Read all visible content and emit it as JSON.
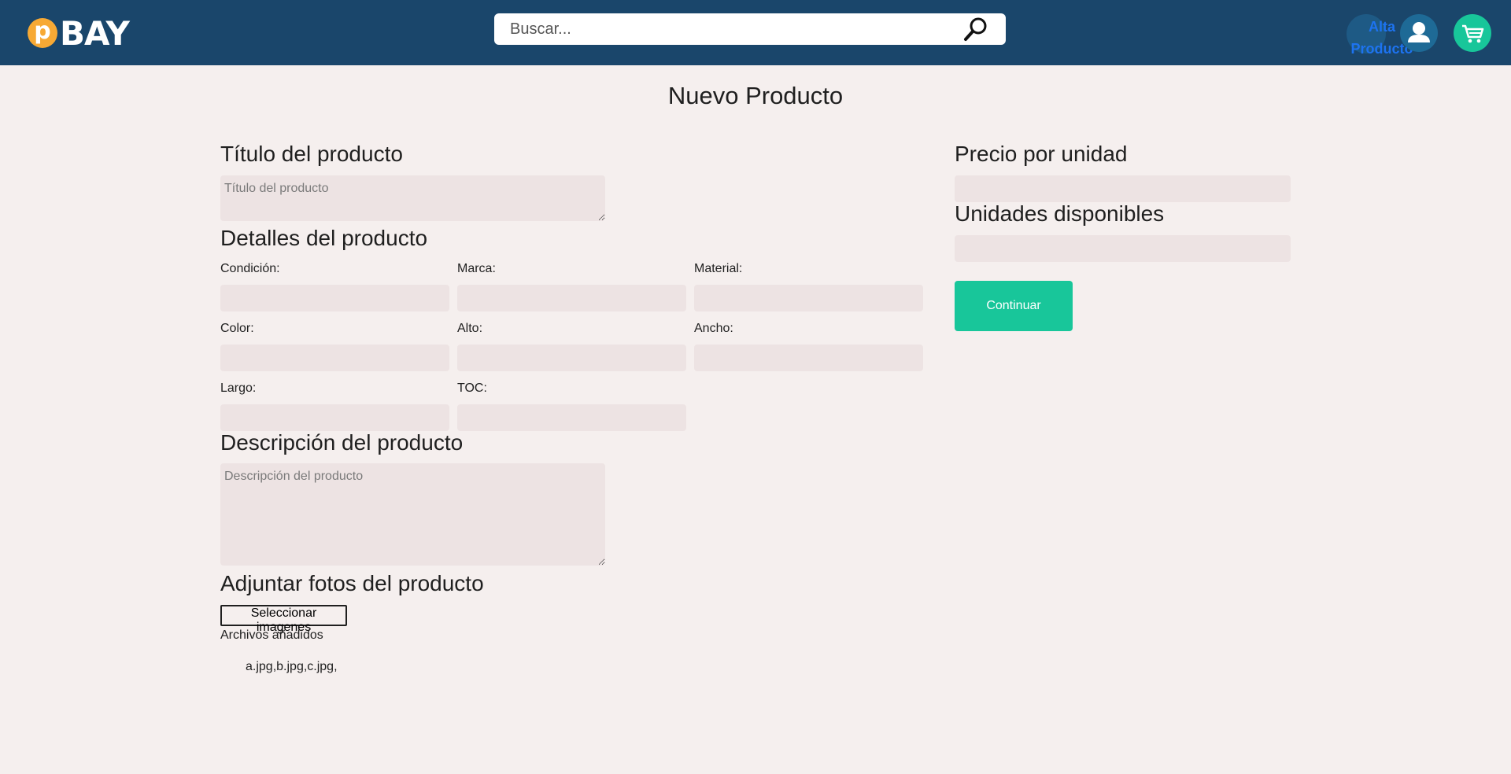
{
  "header": {
    "logo_letter": "p",
    "logo_text": "BAY",
    "search_placeholder": "Buscar...",
    "alta_line1": "Alta",
    "alta_line2": "Producto",
    "colors": {
      "bar": "#1a466b",
      "coin": "#f7a934",
      "cart": "#18c69a",
      "alta_text": "#1d73f0"
    }
  },
  "page": {
    "title": "Nuevo Producto"
  },
  "form": {
    "titulo_heading": "Título del producto",
    "titulo_placeholder": "Título del producto",
    "detalles_heading": "Detalles del producto",
    "details": {
      "condicion": "Condición:",
      "marca": "Marca:",
      "material": "Material:",
      "color": "Color:",
      "alto": "Alto:",
      "ancho": "Ancho:",
      "largo": "Largo:",
      "toc": "TOC:"
    },
    "descripcion_heading": "Descripción del producto",
    "descripcion_placeholder": "Descripción del producto",
    "fotos_heading": "Adjuntar fotos del producto",
    "select_images_label": "Seleccionar imagenes",
    "archivos_label": "Archivos añadidos",
    "archivos_list": "a.jpg,b.jpg,c.jpg,"
  },
  "sidebar": {
    "precio_heading": "Precio por unidad",
    "unidades_heading": "Unidades disponibles",
    "continue_label": "Continuar",
    "accent": "#18c69a"
  }
}
